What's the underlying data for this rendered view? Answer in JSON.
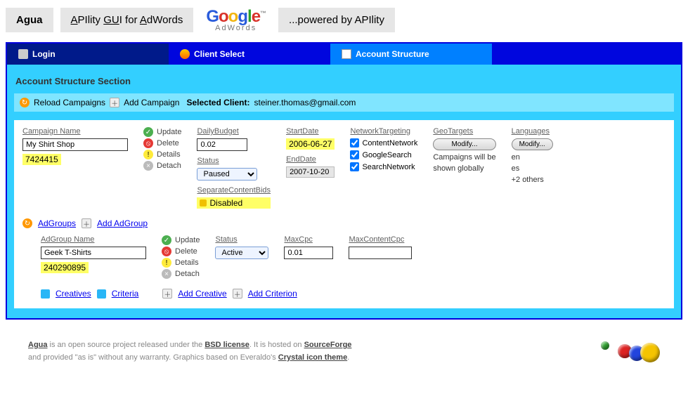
{
  "top": {
    "app": "Agua",
    "tagline_html": "APIlity GUI for AdWords",
    "powered": "...powered by APIlity",
    "google": "Google",
    "google_sub": "AdWords"
  },
  "tabs": {
    "login": "Login",
    "client_select": "Client Select",
    "account_structure": "Account Structure"
  },
  "section": {
    "title": "Account Structure Section",
    "reload": "Reload Campaigns",
    "add_campaign": "Add Campaign",
    "selected_label": "Selected Client:",
    "selected_email": "steiner.thomas@gmail.com"
  },
  "campaign": {
    "name_lbl": "Campaign Name",
    "name_val": "My Shirt Shop",
    "id": "7424415",
    "actions": {
      "update": "Update",
      "delete": "Delete",
      "details": "Details",
      "detach": "Detach"
    },
    "dailybudget_lbl": "DailyBudget",
    "dailybudget_val": "0.02",
    "status_lbl": "Status",
    "status_val": "Paused",
    "scb_lbl": "SeparateContentBids",
    "scb_val": "Disabled",
    "start_lbl": "StartDate",
    "start_val": "2006-06-27",
    "end_lbl": "EndDate",
    "end_val": "2007-10-20",
    "nt_lbl": "NetworkTargeting",
    "nt_opts": [
      "ContentNetwork",
      "GoogleSearch",
      "SearchNetwork"
    ],
    "geo_lbl": "GeoTargets",
    "modify": "Modify...",
    "geo_msg1": "Campaigns will be",
    "geo_msg2": "shown globally",
    "lang_lbl": "Languages",
    "lang_list": [
      "en",
      "es",
      "+2 others"
    ]
  },
  "mid": {
    "adgroups": "AdGroups",
    "add_adgroup": "Add AdGroup"
  },
  "adgroup": {
    "name_lbl": "AdGroup Name",
    "name_val": "Geek T-Shirts",
    "id": "240290895",
    "status_lbl": "Status",
    "status_val": "Active",
    "maxcpc_lbl": "MaxCpc",
    "maxcpc_val": "0.01",
    "maxccpc_lbl": "MaxContentCpc",
    "maxccpc_val": ""
  },
  "bottom": {
    "creatives": "Creatives",
    "criteria": "Criteria",
    "add_creative": "Add Creative",
    "add_criterion": "Add Criterion"
  },
  "footer": {
    "l1a": "Agua",
    "l1b": " is an open source project released under the ",
    "l1c": "BSD license",
    "l1d": ". It is hosted on ",
    "l1e": "SourceForge",
    "l2a": "and provided \"as is\" without any warranty. Graphics based on Everaldo's ",
    "l2b": "Crystal icon theme",
    "l2c": "."
  }
}
